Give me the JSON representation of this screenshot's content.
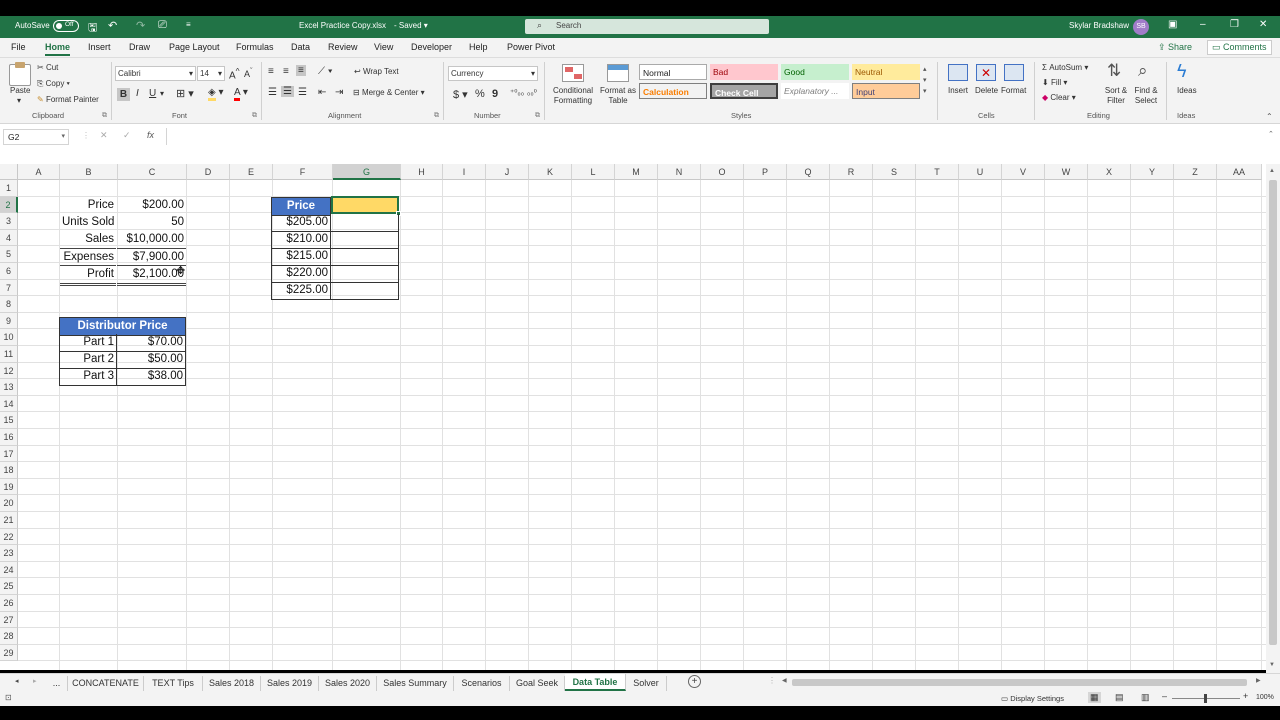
{
  "window": {
    "autosave_label": "AutoSave",
    "autosave_state": "Off",
    "title": "Excel Practice Copy.xlsx",
    "saved_status": "Saved",
    "search_placeholder": "Search",
    "user_name": "Skylar Bradshaw",
    "user_initials": "SB"
  },
  "menu": {
    "tabs": [
      "File",
      "Home",
      "Insert",
      "Draw",
      "Page Layout",
      "Formulas",
      "Data",
      "Review",
      "View",
      "Developer",
      "Help",
      "Power Pivot"
    ],
    "active": "Home",
    "share": "Share",
    "comments": "Comments"
  },
  "ribbon": {
    "clipboard": {
      "paste": "Paste",
      "cut": "Cut",
      "copy": "Copy",
      "format_painter": "Format Painter",
      "group": "Clipboard"
    },
    "font": {
      "name": "Calibri",
      "size": "14",
      "bold": "B",
      "italic": "I",
      "underline": "U",
      "group": "Font"
    },
    "alignment": {
      "wrap": "Wrap Text",
      "merge": "Merge & Center",
      "group": "Alignment"
    },
    "number": {
      "format": "Currency",
      "dollar": "$",
      "percent": "%",
      "comma": "9",
      "group": "Number"
    },
    "styles": {
      "conditional": "Conditional Formatting",
      "format_table": "Format as Table",
      "normal": "Normal",
      "bad": "Bad",
      "good": "Good",
      "neutral": "Neutral",
      "calculation": "Calculation",
      "check_cell": "Check Cell",
      "explanatory": "Explanatory ...",
      "input": "Input",
      "group": "Styles"
    },
    "cells": {
      "insert": "Insert",
      "delete": "Delete",
      "format": "Format",
      "group": "Cells"
    },
    "editing": {
      "autosum": "AutoSum",
      "fill": "Fill",
      "clear": "Clear",
      "sort": "Sort & Filter",
      "find": "Find & Select",
      "group": "Editing"
    },
    "ideas": {
      "label": "Ideas",
      "group": "Ideas"
    }
  },
  "formula_bar": {
    "name_box": "G2",
    "fx": "fx",
    "value": ""
  },
  "columns": [
    "A",
    "B",
    "C",
    "D",
    "E",
    "F",
    "G",
    "H",
    "I",
    "J",
    "K",
    "L",
    "M",
    "N",
    "O",
    "P",
    "Q",
    "R",
    "S",
    "T",
    "U",
    "V",
    "W",
    "X",
    "Y",
    "Z",
    "AA"
  ],
  "rows": [
    "1",
    "2",
    "3",
    "4",
    "5",
    "6",
    "7",
    "8",
    "9",
    "10",
    "11",
    "12",
    "13",
    "14",
    "15",
    "16",
    "17",
    "18",
    "19",
    "20",
    "21",
    "22",
    "23",
    "24",
    "25",
    "26",
    "27",
    "28",
    "29"
  ],
  "cells": {
    "b2": "Price",
    "c2": "$200.00",
    "b3": "Units Sold",
    "c3": "50",
    "b4": "Sales",
    "c4": "$10,000.00",
    "b5": "Expenses",
    "c5": "$7,900.00",
    "b6": "Profit",
    "c6": "$2,100.00",
    "f2": "Price",
    "f3": "$205.00",
    "f4": "$210.00",
    "f5": "$215.00",
    "f6": "$220.00",
    "f7": "$225.00",
    "b9": "Distributor Price",
    "b10": "Part 1",
    "c10": "$70.00",
    "b11": "Part 2",
    "c11": "$50.00",
    "b12": "Part 3",
    "c12": "$38.00"
  },
  "sheets": [
    "...",
    "CONCATENATE",
    "TEXT Tips",
    "Sales 2018",
    "Sales 2019",
    "Sales 2020",
    "Sales Summary",
    "Scenarios",
    "Goal Seek",
    "Data Table",
    "Solver"
  ],
  "active_sheet": "Data Table",
  "status": {
    "display_settings": "Display Settings",
    "zoom": "100%"
  },
  "colors": {
    "excel_green": "#217346",
    "header_blue": "#4472c4",
    "selected_yellow": "#ffd966",
    "bad_bg": "#ffc7ce",
    "good_bg": "#c6efce",
    "neutral_bg": "#ffeb9c",
    "input_bg": "#ffcc99",
    "check_bg": "#a5a5a5"
  }
}
